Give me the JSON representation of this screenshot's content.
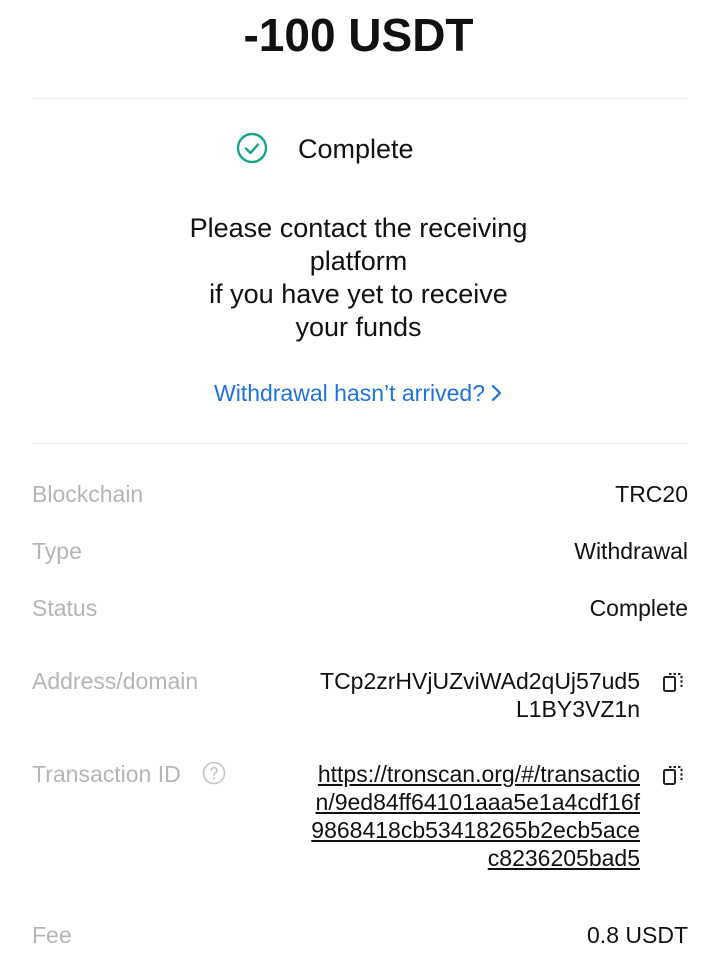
{
  "header": {
    "amount": "-100 USDT"
  },
  "status": {
    "label": "Complete",
    "icon": "check-circle-icon",
    "icon_color": "#17a589"
  },
  "message": "Please contact the receiving\nplatform\nif you have yet to receive\nyour funds",
  "help_link": {
    "label": "Withdrawal hasn’t arrived?",
    "color": "#1f72d8"
  },
  "details": {
    "blockchain": {
      "label": "Blockchain",
      "value": "TRC20"
    },
    "type": {
      "label": "Type",
      "value": "Withdrawal"
    },
    "status": {
      "label": "Status",
      "value": "Complete"
    },
    "address": {
      "label": "Address/domain",
      "value": "TCp2zrHVjUZviWAd2qUj57ud5L1BY3VZ1n",
      "icon": "copy-icon"
    },
    "transaction": {
      "label": "Transaction ID",
      "help_icon": "question-circle-icon",
      "value": "https://tronscan.org/#/transaction/9ed84ff64101aaa5e1a4cdf16f9868418cb53418265b2ecb5acec8236205bad5",
      "icon": "copy-icon"
    },
    "fee": {
      "label": "Fee",
      "value": "0.8 USDT"
    }
  }
}
